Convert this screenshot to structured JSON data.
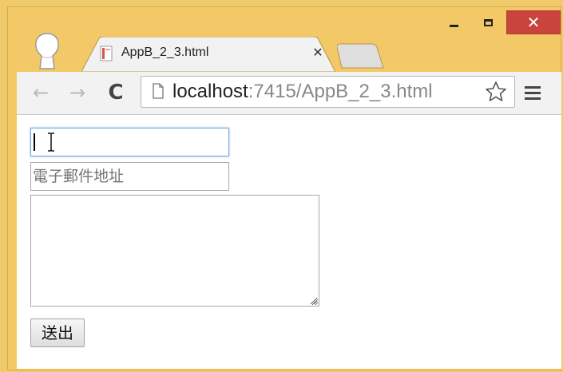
{
  "window": {
    "minimize_icon": "minimize-icon",
    "maximize_icon": "maximize-icon",
    "close_icon": "close-icon",
    "close_glyph": "✕",
    "close_color": "#c8443d",
    "frame_color": "#f2c966"
  },
  "tab": {
    "title": "AppB_2_3.html",
    "close_glyph": "✕",
    "favicon": "page-favicon-icon"
  },
  "toolbar": {
    "back_glyph": "←",
    "forward_glyph": "→",
    "reload_glyph": "C",
    "url_host": "localhost",
    "url_rest": ":7415/AppB_2_3.html",
    "bookmark_icon": "star-icon",
    "menu_icon": "hamburger-menu-icon"
  },
  "form": {
    "text_value": "",
    "email_placeholder": "電子郵件地址",
    "textarea_value": "",
    "submit_label": "送出"
  }
}
